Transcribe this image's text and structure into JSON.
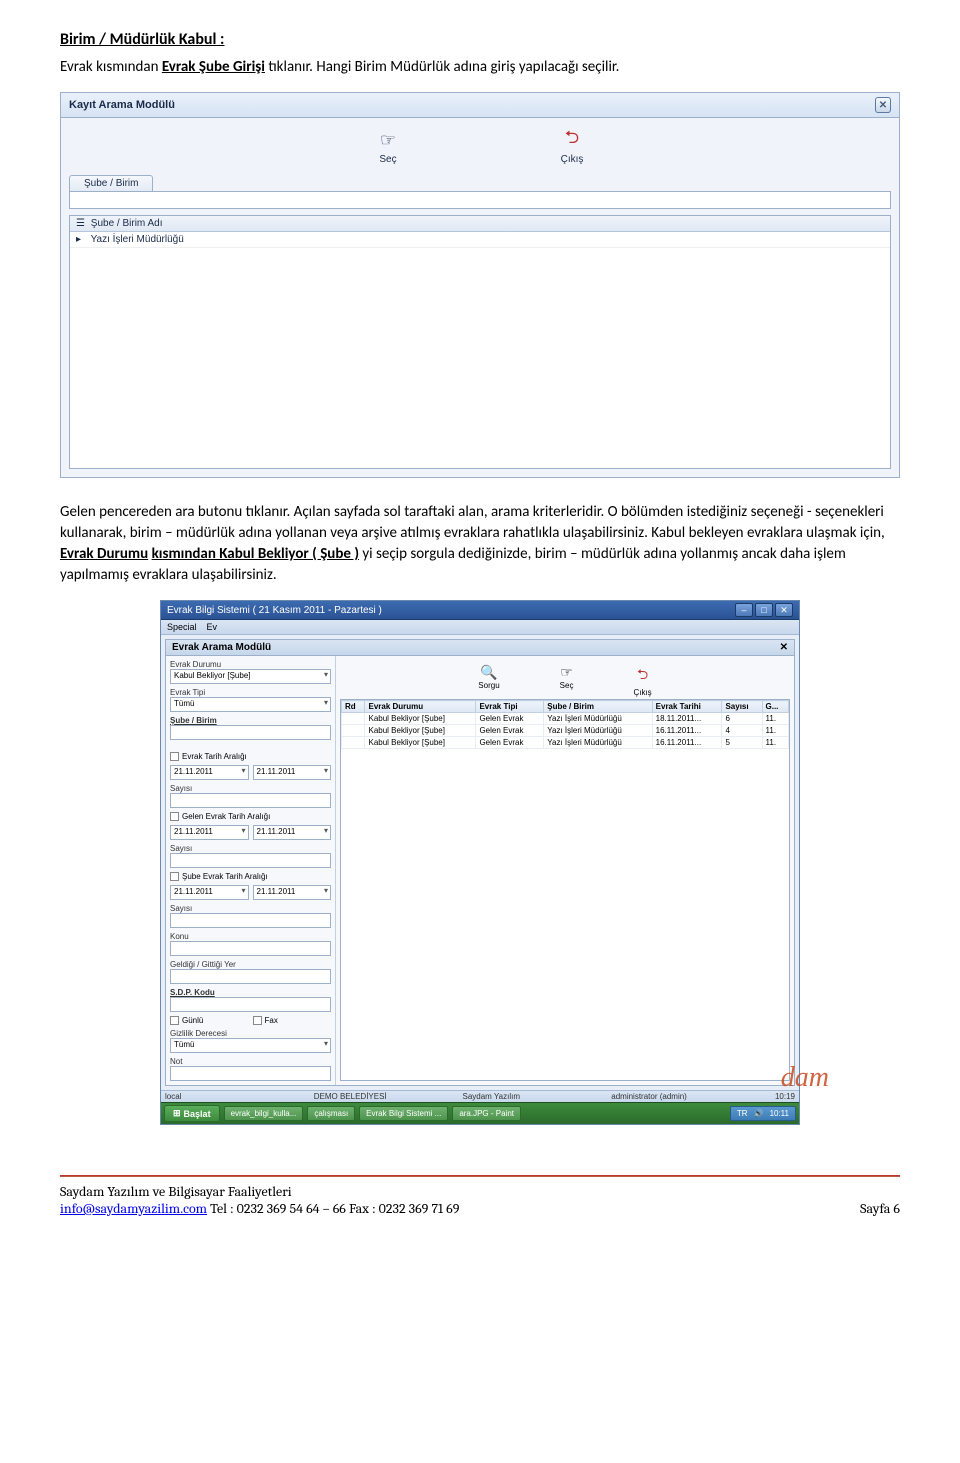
{
  "heading": "Birim / Müdürlük Kabul :",
  "para1_pre": "Evrak kısmından ",
  "para1_link": "Evrak Şube Girişi",
  "para1_post": " tıklanır. Hangi Birim Müdürlük adına giriş yapılacağı seçilir.",
  "ss1": {
    "title": "Kayıt Arama Modülü",
    "btn_sec": "Seç",
    "btn_cikis": "Çıkış",
    "tab": "Şube / Birim",
    "col": "Şube / Birim Adı",
    "row": "Yazı İşleri Müdürlüğü"
  },
  "para2_plain1": "Gelen pencereden ara butonu tıklanır. Açılan sayfada sol taraftaki alan, arama kriterleridir. O bölümden istediğiniz seçeneği - seçenekleri kullanarak, birim – müdürlük adına yollanan veya arşive atılmış evraklara rahatlıkla ulaşabilirsiniz. Kabul bekleyen evraklara ulaşmak için, ",
  "para2_bold1": "Evrak Durumu",
  "para2_plain2": " ",
  "para2_bold2": "kısmından Kabul Bekliyor ( Şube )",
  "para2_plain3": " yi seçip sorgula dediğinizde, birim – müdürlük adına yollanmış ancak daha işlem yapılmamış evraklara ulaşabilirsiniz.",
  "ss2": {
    "app_title": "Evrak Bilgi Sistemi  ( 21 Kasım 2011 - Pazartesi )",
    "mod_title": "Evrak Arama Modülü",
    "menu": {
      "special": "Special",
      "ev": "Ev"
    },
    "btn_sorgu": "Sorgu",
    "btn_sec": "Seç",
    "btn_cikis": "Çıkış",
    "filters": {
      "evrak_durumu_lbl": "Evrak Durumu",
      "evrak_durumu_val": "Kabul Bekliyor [Şube]",
      "evrak_tipi_lbl": "Evrak Tipi",
      "evrak_tipi_val": "Tümü",
      "sube_birim_lbl": "Şube / Birim",
      "evrak_tarih_lbl": "Evrak Tarih Aralığı",
      "date1": "21.11.2011",
      "date2": "21.11.2011",
      "sayısı_lbl": "Sayısı",
      "gelen_tarih_lbl": "Gelen Evrak Tarih Aralığı",
      "sube_tarih_lbl": "Şube Evrak Tarih Aralığı",
      "konu_lbl": "Konu",
      "geldigi_lbl": "Geldiği / Gittiği Yer",
      "sdp_lbl": "S.D.P. Kodu",
      "gunlu_lbl": "Günlü",
      "fax_lbl": "Fax",
      "gizlilik_lbl": "Gizlilik Derecesi",
      "gizlilik_val": "Tümü",
      "not_lbl": "Not"
    },
    "grid": {
      "cols": [
        "Rd",
        "Evrak Durumu",
        "Evrak Tipi",
        "Şube / Birim",
        "Evrak Tarihi",
        "Sayısı",
        "G..."
      ],
      "rows": [
        [
          "",
          "Kabul Bekliyor [Şube]",
          "Gelen Evrak",
          "Yazı İşleri Müdürlüğü",
          "18.11.2011...",
          "6",
          "11."
        ],
        [
          "",
          "Kabul Bekliyor [Şube]",
          "Gelen Evrak",
          "Yazı İşleri Müdürlüğü",
          "16.11.2011...",
          "4",
          "11."
        ],
        [
          "",
          "Kabul Bekliyor [Şube]",
          "Gelen Evrak",
          "Yazı İşleri Müdürlüğü",
          "16.11.2011...",
          "5",
          "11."
        ]
      ]
    },
    "status": {
      "local": "local",
      "belediye": "DEMO BELEDİYESİ",
      "saydam": "Saydam Yazılım",
      "admin": "administrator (admin)",
      "time1": "10:19"
    },
    "taskbar": {
      "start": "Başlat",
      "t1": "evrak_bilgi_kulla...",
      "t2": "çalışması",
      "t3": "Evrak Bilgi Sistemi ...",
      "t4": "ara.JPG - Paint",
      "tray_tr": "TR",
      "tray_time": "10:11"
    }
  },
  "footer": {
    "line1": "Saydam Yazılım ve Bilgisayar Faaliyetleri",
    "email": "info@saydamyazilim.com",
    "tel": " Tel  : 0232 369 54 64 – 66 Fax : 0232 369 71 69",
    "page": "Sayfa 6"
  }
}
